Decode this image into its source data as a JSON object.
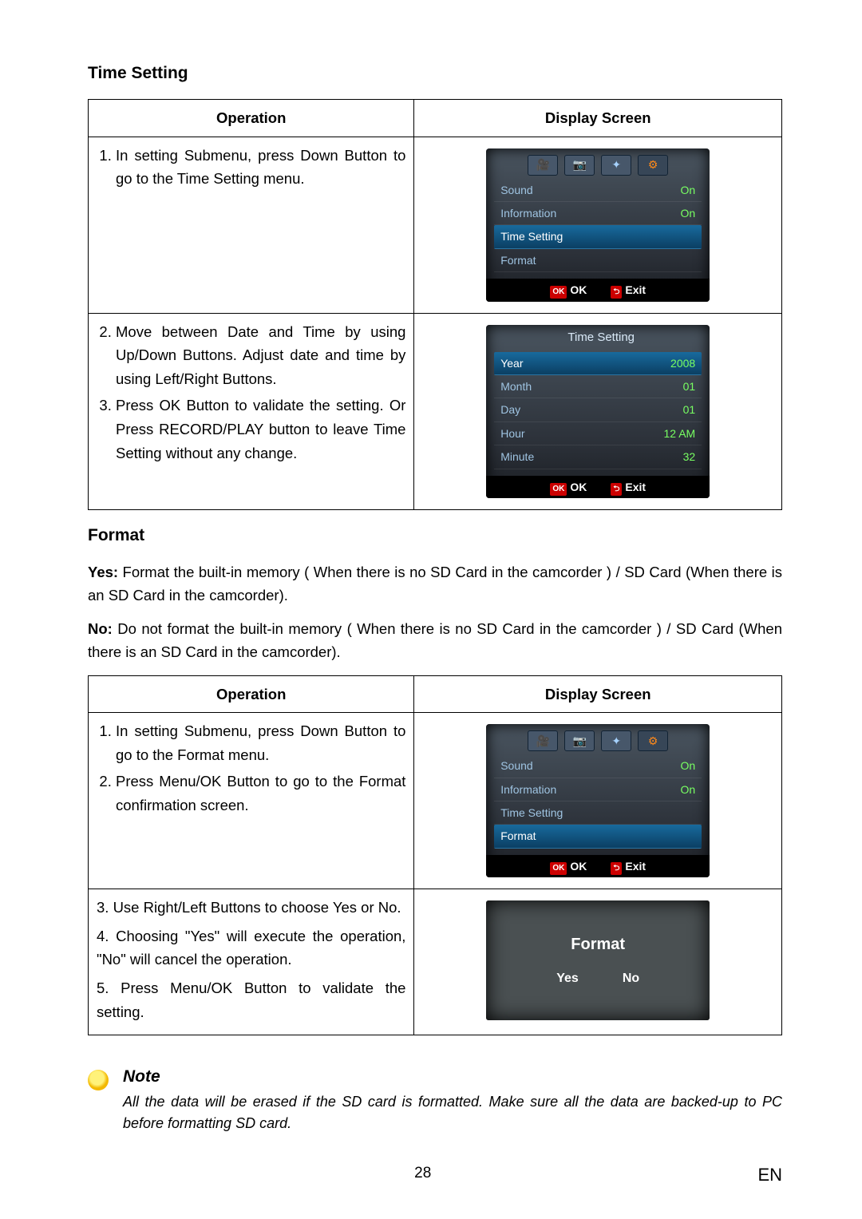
{
  "sections": {
    "timeSetting": {
      "heading": "Time Setting",
      "headers": {
        "operation": "Operation",
        "display": "Display Screen"
      },
      "row1": {
        "step1": "In setting Submenu, press Down Button to go to the Time Setting menu."
      },
      "row2": {
        "step2": "Move between Date and Time by using Up/Down Buttons. Adjust date and time by using Left/Right Buttons.",
        "step3": "Press OK Button to validate the setting. Or Press RECORD/PLAY button to leave Time Setting without any change."
      },
      "lcd1": {
        "items": [
          {
            "label": "Sound",
            "value": "On"
          },
          {
            "label": "Information",
            "value": "On"
          },
          {
            "label": "Time Setting",
            "value": ""
          },
          {
            "label": "Format",
            "value": ""
          }
        ],
        "highlightIndex": 2,
        "foot": {
          "okBadge": "OK",
          "ok": "OK",
          "exit": "Exit"
        }
      },
      "lcd2": {
        "title": "Time  Setting",
        "items": [
          {
            "label": "Year",
            "value": "2008"
          },
          {
            "label": "Month",
            "value": "01"
          },
          {
            "label": "Day",
            "value": "01"
          },
          {
            "label": "Hour",
            "value": "12 AM"
          },
          {
            "label": "Minute",
            "value": "32"
          }
        ],
        "highlightIndex": 0,
        "foot": {
          "okBadge": "OK",
          "ok": "OK",
          "exit": "Exit"
        }
      }
    },
    "format": {
      "heading": "Format",
      "yesPara": {
        "lead": "Yes:",
        "text": " Format the built-in memory ( When there is no SD Card in the camcorder ) / SD Card (When there is an SD Card in the camcorder)."
      },
      "noPara": {
        "lead": "No:",
        "text": " Do not format the built-in memory ( When there is no SD Card in the camcorder ) / SD Card (When there is an SD Card in the camcorder)."
      },
      "headers": {
        "operation": "Operation",
        "display": "Display Screen"
      },
      "row1": {
        "step1": "In setting Submenu, press Down Button to go to the Format menu.",
        "step2": "Press Menu/OK Button to go to the Format confirmation screen."
      },
      "row2": {
        "line3": "3. Use Right/Left Buttons to choose Yes or No.",
        "line4": "4. Choosing \"Yes\" will execute the operation, \"No\" will cancel the operation.",
        "line5": "5. Press Menu/OK Button to validate the setting."
      },
      "lcd1": {
        "items": [
          {
            "label": "Sound",
            "value": "On"
          },
          {
            "label": "Information",
            "value": "On"
          },
          {
            "label": "Time Setting",
            "value": ""
          },
          {
            "label": "Format",
            "value": ""
          }
        ],
        "highlightIndex": 3,
        "foot": {
          "okBadge": "OK",
          "ok": "OK",
          "exit": "Exit"
        }
      },
      "lcd2": {
        "title": "Format",
        "yes": "Yes",
        "no": "No"
      }
    }
  },
  "note": {
    "heading": "Note",
    "text": "All the data will be erased if the SD card is formatted. Make sure all the data are backed-up to PC before formatting SD card."
  },
  "footer": {
    "page": "28",
    "lang": "EN"
  }
}
